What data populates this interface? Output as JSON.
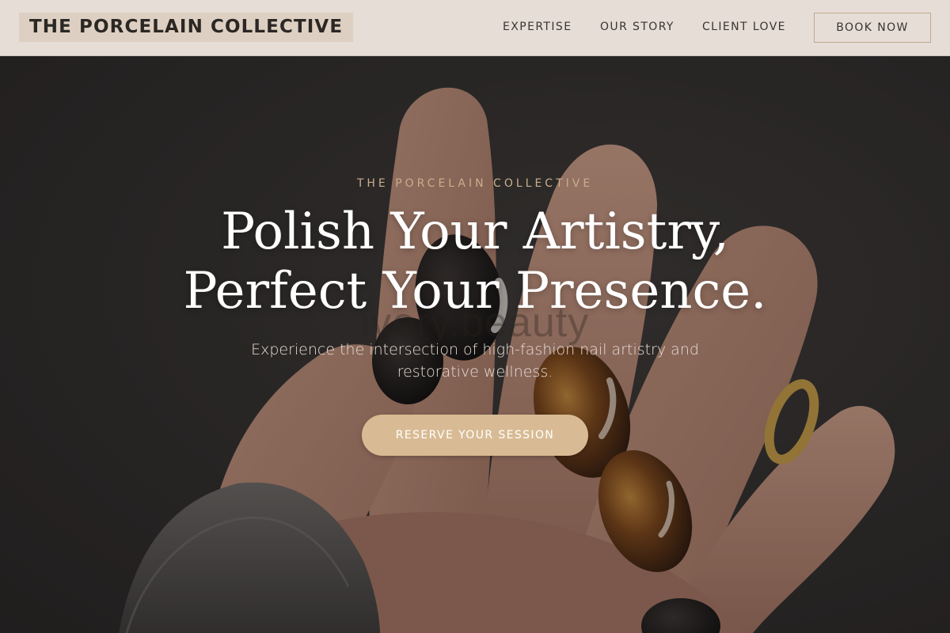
{
  "header": {
    "logo": "THE PORCELAIN COLLECTIVE",
    "nav": [
      "EXPERTISE",
      "OUR STORY",
      "CLIENT LOVE"
    ],
    "book_label": "BOOK NOW"
  },
  "hero": {
    "eyebrow": "THE PORCELAIN COLLECTIVE",
    "headline_line1": "Polish Your Artistry,",
    "headline_line2": "Perfect Your Presence.",
    "subtext": "Experience the intersection of high-fashion nail artistry and restorative wellness.",
    "cta_label": "RESERVE YOUR SESSION",
    "watermark": "ivory.beauty",
    "image_subject": "hand with tortoiseshell and black glossy nails over grey knit sweater"
  },
  "colors": {
    "header_bg": "#e6ddd6",
    "logo_bg": "#ddd0c2",
    "accent": "#d8bb94",
    "eyebrow": "#c9ad8d",
    "hero_bg": "#302e2d",
    "text_dark": "#2b2724"
  }
}
